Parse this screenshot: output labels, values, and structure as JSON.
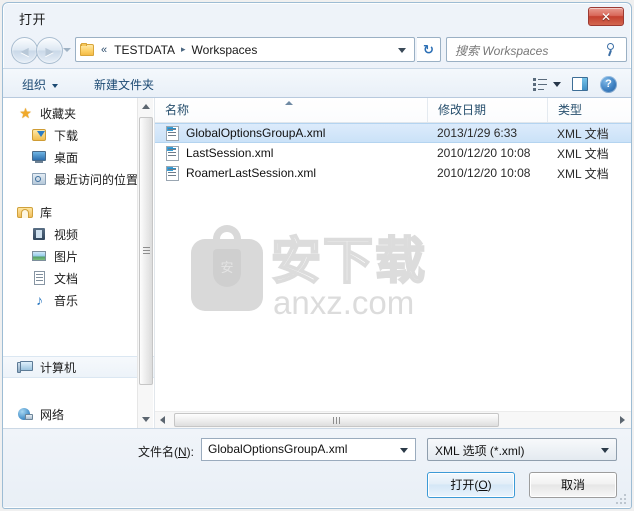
{
  "window": {
    "title": "打开",
    "close_label": "✕"
  },
  "nav": {
    "back_icon": "back-arrow-icon",
    "forward_icon": "forward-arrow-icon",
    "history_dropdown_icon": "chevron-down-icon",
    "address": {
      "folder_icon": "folder-icon",
      "overflow_chevrons": "«",
      "crumbs": [
        {
          "label": "TESTDATA"
        },
        {
          "label": "Workspaces"
        }
      ],
      "separator": "▸",
      "dropdown_icon": "chevron-down-icon"
    },
    "refresh_icon": "refresh-icon",
    "search": {
      "placeholder": "搜索 Workspaces",
      "value": "",
      "icon": "search-icon"
    }
  },
  "toolbar": {
    "organize_label": "组织",
    "new_folder_label": "新建文件夹",
    "views_icon": "view-list-icon",
    "views_caret_icon": "chevron-down-icon",
    "preview_pane_icon": "preview-pane-icon",
    "help_icon": "help-icon",
    "help_glyph": "?"
  },
  "sidebar": {
    "groups": [
      {
        "header": {
          "label": "收藏夹",
          "icon": "star-icon"
        },
        "items": [
          {
            "label": "下载",
            "icon": "download-icon"
          },
          {
            "label": "桌面",
            "icon": "desktop-icon"
          },
          {
            "label": "最近访问的位置",
            "icon": "recent-places-icon"
          }
        ]
      },
      {
        "header": {
          "label": "库",
          "icon": "library-icon"
        },
        "items": [
          {
            "label": "视频",
            "icon": "video-icon"
          },
          {
            "label": "图片",
            "icon": "picture-icon"
          },
          {
            "label": "文档",
            "icon": "document-icon"
          },
          {
            "label": "音乐",
            "icon": "music-icon"
          }
        ]
      },
      {
        "header": {
          "label": "计算机",
          "icon": "computer-icon",
          "selected": true
        },
        "items": []
      },
      {
        "header": {
          "label": "网络",
          "icon": "network-icon"
        },
        "items": []
      }
    ],
    "scrollbar": {
      "up_icon": "scroll-up-icon",
      "down_icon": "scroll-down-icon"
    }
  },
  "filelist": {
    "columns": [
      {
        "key": "name",
        "label": "名称",
        "sorted": true,
        "sort_direction": "asc"
      },
      {
        "key": "date",
        "label": "修改日期"
      },
      {
        "key": "type",
        "label": "类型"
      }
    ],
    "rows": [
      {
        "name": "GlobalOptionsGroupA.xml",
        "date": "2013/1/29 6:33",
        "type": "XML 文档",
        "icon": "xml-file-icon",
        "selected": true
      },
      {
        "name": "LastSession.xml",
        "date": "2010/12/20 10:08",
        "type": "XML 文档",
        "icon": "xml-file-icon",
        "selected": false
      },
      {
        "name": "RoamerLastSession.xml",
        "date": "2010/12/20 10:08",
        "type": "XML 文档",
        "icon": "xml-file-icon",
        "selected": false
      }
    ],
    "h_scrollbar": {
      "left_icon": "scroll-left-icon",
      "right_icon": "scroll-right-icon"
    }
  },
  "watermark": {
    "logo_char": "安",
    "chinese": "安下载",
    "url": "anxz.com"
  },
  "footer": {
    "filename_label_prefix": "文件名(",
    "filename_label_key": "N",
    "filename_label_suffix": "):",
    "filename_value": "GlobalOptionsGroupA.xml",
    "filename_dropdown_icon": "chevron-down-icon",
    "filetype_value": "XML 选项 (*.xml)",
    "filetype_dropdown_icon": "chevron-down-icon",
    "open_button_prefix": "打开(",
    "open_button_key": "O",
    "open_button_suffix": ")",
    "cancel_button_label": "取消",
    "resize_grip_icon": "resize-grip-icon"
  },
  "colors": {
    "accent": "#3c9ad6",
    "selection": "#cbe2f8",
    "header_text": "#28506e",
    "close_red": "#c4402f"
  }
}
